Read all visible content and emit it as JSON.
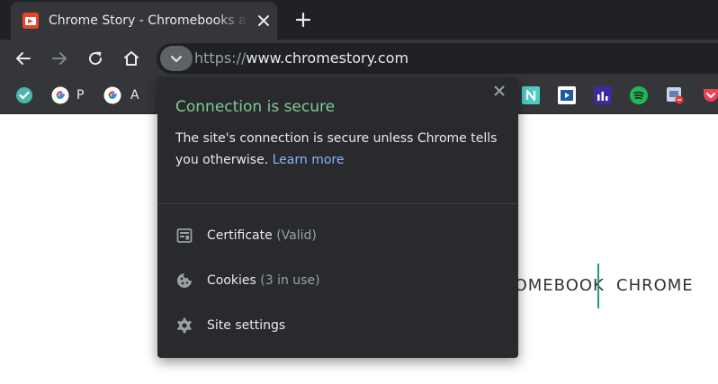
{
  "tab": {
    "title": "Chrome Story - Chromebooks and Chrome OS",
    "favicon": "chrome-story-favicon",
    "close_icon": "close-icon"
  },
  "new_tab_icon": "plus-icon",
  "toolbar": {
    "back_icon": "back-arrow-icon",
    "forward_icon": "forward-arrow-icon",
    "reload_icon": "reload-icon",
    "home_icon": "home-icon",
    "site_info_icon": "chevron-down-icon"
  },
  "address": {
    "scheme": "https://",
    "host": "www.chromestory.com"
  },
  "bookmarks": [
    {
      "icon": "teal-check-icon",
      "label": ""
    },
    {
      "icon": "google-icon",
      "label": "P"
    },
    {
      "icon": "google-icon",
      "label": "A"
    },
    {
      "icon": "notion-n-icon",
      "label": ""
    },
    {
      "icon": "video-play-icon",
      "label": ""
    },
    {
      "icon": "bar-chart-icon",
      "label": ""
    },
    {
      "icon": "spotify-icon",
      "label": ""
    },
    {
      "icon": "photo-badge-icon",
      "label": ""
    },
    {
      "icon": "pocket-icon",
      "label": ""
    }
  ],
  "popup": {
    "title": "Connection is secure",
    "description": "The site's connection is secure unless Chrome tells you otherwise.",
    "learn_more": "Learn more",
    "close_icon": "close-icon",
    "items": [
      {
        "icon": "certificate-icon",
        "label": "Certificate",
        "sub": "(Valid)"
      },
      {
        "icon": "cookie-icon",
        "label": "Cookies",
        "sub": "(3 in use)"
      },
      {
        "icon": "gear-icon",
        "label": "Site settings",
        "sub": ""
      }
    ]
  },
  "page": {
    "nav": [
      "CHROMEBOOK",
      "CHROME"
    ]
  },
  "colors": {
    "secure_green": "#81c995",
    "link_blue": "#8ab4f8",
    "nav_divider": "#1aa36f"
  }
}
